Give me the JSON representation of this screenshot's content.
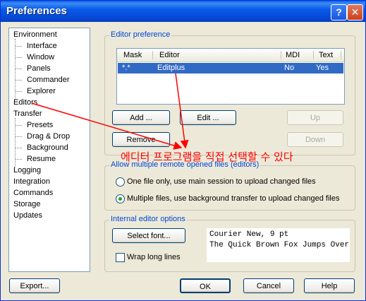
{
  "window": {
    "title": "Preferences",
    "help_glyph": "?",
    "close_glyph": "✕"
  },
  "tree": {
    "items": [
      {
        "label": "Environment"
      },
      {
        "label": "Interface"
      },
      {
        "label": "Window"
      },
      {
        "label": "Panels"
      },
      {
        "label": "Commander"
      },
      {
        "label": "Explorer"
      },
      {
        "label": "Editors"
      },
      {
        "label": "Transfer"
      },
      {
        "label": "Presets"
      },
      {
        "label": "Drag & Drop"
      },
      {
        "label": "Background"
      },
      {
        "label": "Resume"
      },
      {
        "label": "Logging"
      },
      {
        "label": "Integration"
      },
      {
        "label": "Commands"
      },
      {
        "label": "Storage"
      },
      {
        "label": "Updates"
      }
    ]
  },
  "editor_preference": {
    "title": "Editor preference",
    "columns": [
      "Mask",
      "Editor",
      "MDI",
      "Text"
    ],
    "rows": [
      {
        "mask": "*.*",
        "editor": "Editplus",
        "mdi": "No",
        "text": "Yes"
      }
    ],
    "buttons": {
      "add": "Add ...",
      "edit": "Edit ...",
      "up": "Up",
      "remove": "Remove",
      "down": "Down"
    }
  },
  "annotation": {
    "text": "에디터 프로그램을 직접 선택할 수 있다",
    "color": "#ff0000"
  },
  "multiple_files": {
    "title": "Allow multiple remote opened files (editors)",
    "option_one": "One file only, use main session to upload changed files",
    "option_multiple": "Multiple files, use background transfer to upload changed files",
    "selected": "multiple"
  },
  "internal_editor": {
    "title": "Internal editor options",
    "select_font": "Select font...",
    "wrap_lines": "Wrap long lines",
    "wrap_checked": false,
    "font_name": "Courier New, 9 pt",
    "sample": "The Quick Brown Fox Jumps Over"
  },
  "footer": {
    "export": "Export...",
    "ok": "OK",
    "cancel": "Cancel",
    "help": "Help"
  },
  "colors": {
    "title_bar": "#0a5be8",
    "selection": "#316ac5",
    "group_title": "#0046d5",
    "accent_radio": "#21a121"
  }
}
